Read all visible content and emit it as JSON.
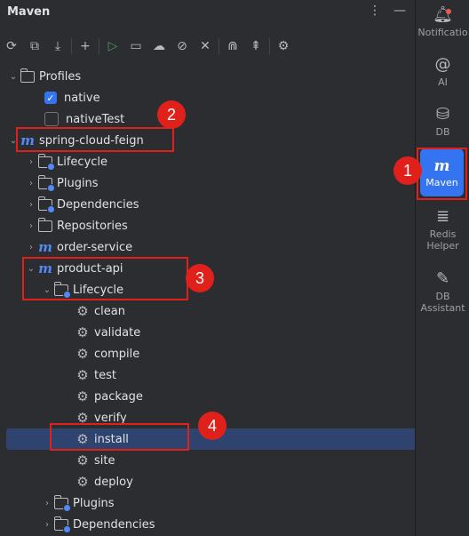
{
  "panel": {
    "title": "Maven"
  },
  "tree": {
    "profiles_label": "Profiles",
    "native": "native",
    "nativeTest": "nativeTest",
    "root": "spring-cloud-feign",
    "lifecycle": "Lifecycle",
    "plugins": "Plugins",
    "dependencies": "Dependencies",
    "repositories": "Repositories",
    "order_service": "order-service",
    "product_api": "product-api",
    "pa_lifecycle": "Lifecycle",
    "phases": [
      "clean",
      "validate",
      "compile",
      "test",
      "package",
      "verify",
      "install",
      "site",
      "deploy"
    ],
    "pa_plugins": "Plugins",
    "pa_dependencies": "Dependencies"
  },
  "rightbar": {
    "notifications": "Notificatio",
    "ai": "AI",
    "db": "DB",
    "maven": "Maven",
    "redis_1": "Redis",
    "redis_2": "Helper",
    "dba_1": "DB",
    "dba_2": "Assistant"
  },
  "annotations": [
    "1",
    "2",
    "3",
    "4"
  ],
  "colors": {
    "accent": "#3574f0",
    "highlight": "#e0201b",
    "selected_row": "#2e436e"
  }
}
